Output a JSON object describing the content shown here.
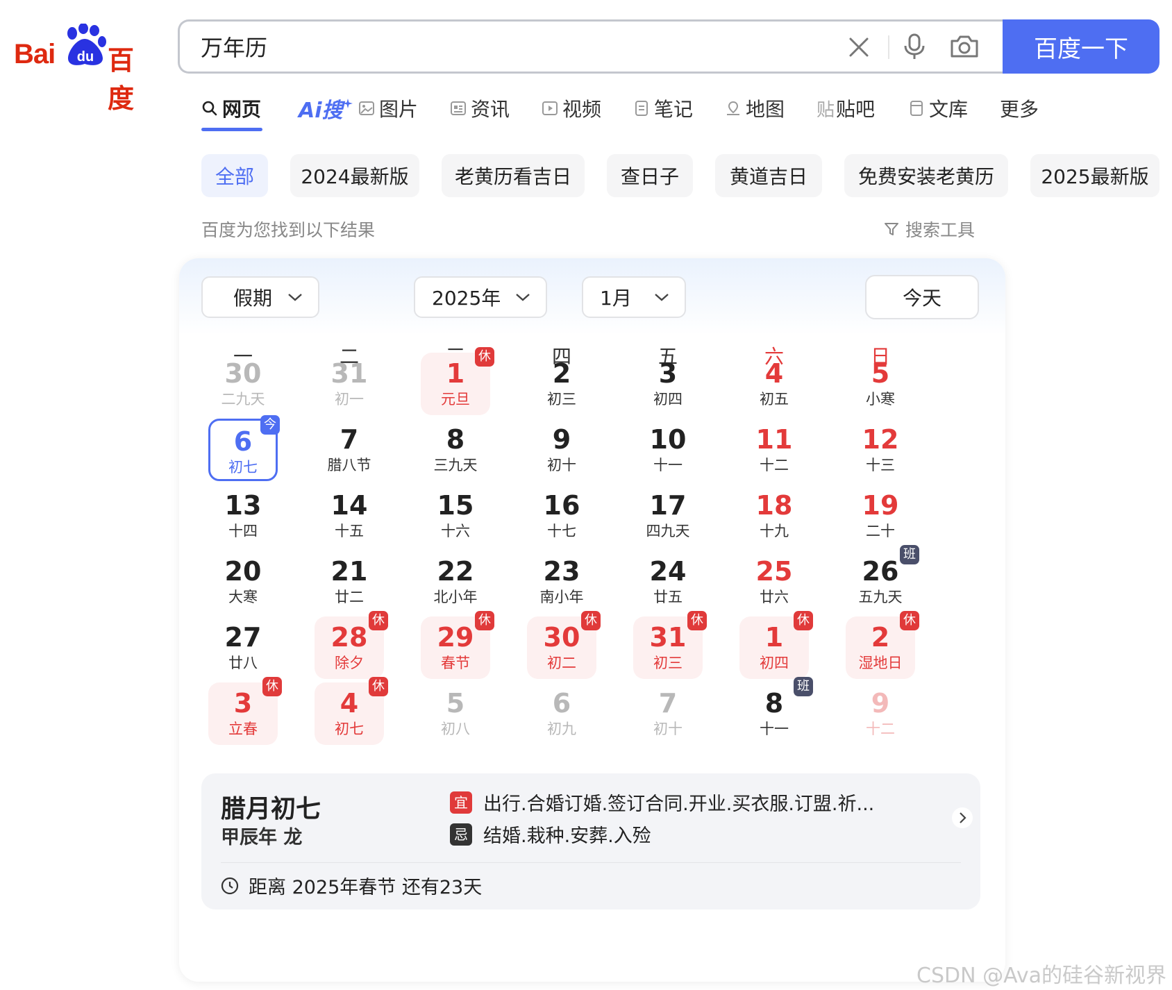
{
  "logo": {
    "text_latin": "Bai",
    "text_du": "du",
    "text_cn": "百度"
  },
  "search": {
    "query": "万年历",
    "button_label": "百度一下"
  },
  "tabs": [
    {
      "label": "网页"
    },
    {
      "label": "Ai搜"
    },
    {
      "label": "图片"
    },
    {
      "label": "资讯"
    },
    {
      "label": "视频"
    },
    {
      "label": "笔记"
    },
    {
      "label": "地图"
    },
    {
      "label": "贴吧"
    },
    {
      "label": "文库"
    },
    {
      "label": "更多"
    }
  ],
  "chips": [
    "全部",
    "2024最新版",
    "老黄历看吉日",
    "查日子",
    "黄道吉日",
    "免费安装老黄历",
    "2025最新版"
  ],
  "result_note": "百度为您找到以下结果",
  "search_tools": "搜索工具",
  "calendar": {
    "holiday_select": "假期",
    "year_select": "2025年",
    "month_select": "1月",
    "today_button": "今天",
    "weekdays": [
      "一",
      "二",
      "三",
      "四",
      "五",
      "六",
      "日"
    ],
    "weeks": [
      [
        {
          "n": "30",
          "l": "二九天",
          "t": "other"
        },
        {
          "n": "31",
          "l": "初一",
          "t": "other"
        },
        {
          "n": "1",
          "l": "元旦",
          "t": "holiday",
          "b": "休"
        },
        {
          "n": "2",
          "l": "初三"
        },
        {
          "n": "3",
          "l": "初四"
        },
        {
          "n": "4",
          "l": "初五",
          "t": "weekend"
        },
        {
          "n": "5",
          "l": "小寒",
          "t": "weekend"
        }
      ],
      [
        {
          "n": "6",
          "l": "初七",
          "t": "today",
          "b": "今"
        },
        {
          "n": "7",
          "l": "腊八节"
        },
        {
          "n": "8",
          "l": "三九天"
        },
        {
          "n": "9",
          "l": "初十"
        },
        {
          "n": "10",
          "l": "十一"
        },
        {
          "n": "11",
          "l": "十二",
          "t": "weekend"
        },
        {
          "n": "12",
          "l": "十三",
          "t": "weekend"
        }
      ],
      [
        {
          "n": "13",
          "l": "十四"
        },
        {
          "n": "14",
          "l": "十五"
        },
        {
          "n": "15",
          "l": "十六"
        },
        {
          "n": "16",
          "l": "十七"
        },
        {
          "n": "17",
          "l": "四九天"
        },
        {
          "n": "18",
          "l": "十九",
          "t": "weekend"
        },
        {
          "n": "19",
          "l": "二十",
          "t": "weekend"
        }
      ],
      [
        {
          "n": "20",
          "l": "大寒"
        },
        {
          "n": "21",
          "l": "廿二"
        },
        {
          "n": "22",
          "l": "北小年"
        },
        {
          "n": "23",
          "l": "南小年"
        },
        {
          "n": "24",
          "l": "廿五"
        },
        {
          "n": "25",
          "l": "廿六",
          "t": "weekend"
        },
        {
          "n": "26",
          "l": "五九天",
          "b": "班"
        }
      ],
      [
        {
          "n": "27",
          "l": "廿八"
        },
        {
          "n": "28",
          "l": "除夕",
          "t": "holiday",
          "b": "休"
        },
        {
          "n": "29",
          "l": "春节",
          "t": "holiday",
          "b": "休"
        },
        {
          "n": "30",
          "l": "初二",
          "t": "holiday",
          "b": "休"
        },
        {
          "n": "31",
          "l": "初三",
          "t": "holiday",
          "b": "休"
        },
        {
          "n": "1",
          "l": "初四",
          "t": "holiday",
          "b": "休"
        },
        {
          "n": "2",
          "l": "湿地日",
          "t": "holiday",
          "b": "休"
        }
      ],
      [
        {
          "n": "3",
          "l": "立春",
          "t": "holiday",
          "b": "休"
        },
        {
          "n": "4",
          "l": "初七",
          "t": "holiday",
          "b": "休"
        },
        {
          "n": "5",
          "l": "初八",
          "t": "other"
        },
        {
          "n": "6",
          "l": "初九",
          "t": "other"
        },
        {
          "n": "7",
          "l": "初十",
          "t": "other"
        },
        {
          "n": "8",
          "l": "十一",
          "b": "班"
        },
        {
          "n": "9",
          "l": "十二",
          "t": "other weekend"
        }
      ]
    ]
  },
  "info": {
    "lunar_date": "腊月初七",
    "lunar_year": "甲辰年 龙",
    "yi_tag": "宜",
    "yi_text": "出行.合婚订婚.签订合同.开业.买衣服.订盟.祈...",
    "ji_tag": "忌",
    "ji_text": "结婚.栽种.安葬.入殓",
    "countdown": "距离 2025年春节 还有23天"
  },
  "watermark": "CSDN @Ava的硅谷新视界",
  "colors": {
    "brand_blue": "#4e6ef2",
    "baidu_red": "#de2910",
    "holiday_red": "#e33a3a"
  }
}
